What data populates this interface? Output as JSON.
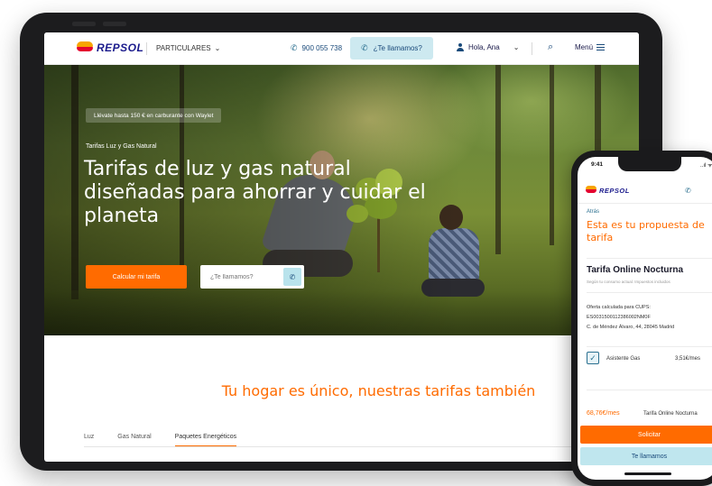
{
  "tablet": {
    "header": {
      "brand": "REPSOL",
      "segment": "PARTICULARES",
      "phone": "900 055 738",
      "call_button": "¿Te llamamos?",
      "user": "Hola, Ana",
      "menu": "Menú"
    },
    "hero": {
      "promo": "Llévate hasta 150 € en carburante con Waylet",
      "kicker": "Tarifas Luz y Gas Natural",
      "title": "Tarifas de luz y gas natural diseñadas para ahorrar y cuidar el planeta",
      "cta": "Calcular mi tarifa",
      "call_placeholder": "¿Te llamamos?"
    },
    "section": {
      "title": "Tu hogar es único, nuestras tarifas también",
      "tabs": [
        "Luz",
        "Gas Natural",
        "Paquetes Energéticos"
      ]
    }
  },
  "phone": {
    "status_time": "9:41",
    "status_icons": "..ıl ᯤ",
    "brand": "REPSOL",
    "back": "Atrás",
    "title": "Esta es tu propuesta de tarifa",
    "tarifa": "Tarifa Online Nocturna",
    "note": "Según tu consumo actual. Impuestos incluidos",
    "cups_label": "Oferta calculada para CUPS:",
    "cups_code": "ES0031500112386002NM0F",
    "address": "C. de Méndez Álvaro, 44, 28045 Madrid",
    "addon": "Asistente Gas",
    "addon_price": "3,51€/mes",
    "price": "68,76€/mes",
    "price_name": "Tarifa Online Nocturna",
    "solicitar": "Solicitar",
    "llamamos": "Te llamamos"
  },
  "colors": {
    "accent_orange": "#ff6b00",
    "brand_blue": "#1a1a8c",
    "call_blue": "#cde9f0"
  }
}
